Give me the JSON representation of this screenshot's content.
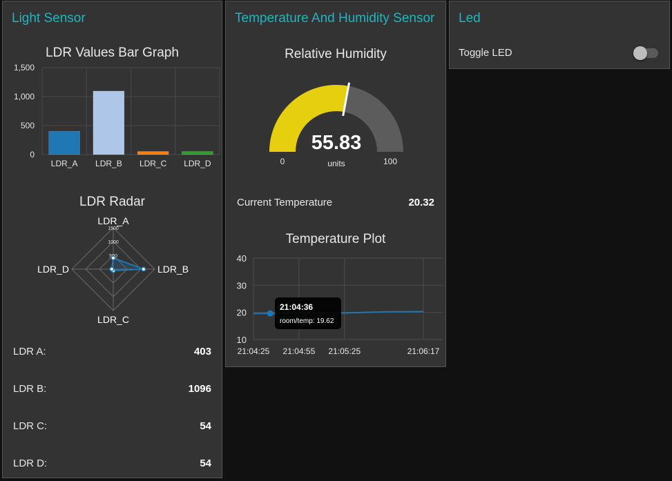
{
  "light_sensor": {
    "title": "Light Sensor",
    "bar_graph": {
      "title": "LDR Values Bar Graph",
      "y_ticks": [
        "1,500",
        "1,000",
        "500",
        "0"
      ],
      "categories": [
        "LDR_A",
        "LDR_B",
        "LDR_C",
        "LDR_D"
      ]
    },
    "radar": {
      "title": "LDR Radar",
      "axes": [
        "LDR_A",
        "LDR_B",
        "LDR_C",
        "LDR_D"
      ],
      "ring_labels": [
        "1500",
        "1000",
        "500"
      ]
    },
    "readings": [
      {
        "label": "LDR A:",
        "value": "403"
      },
      {
        "label": "LDR B:",
        "value": "1096"
      },
      {
        "label": "LDR C:",
        "value": "54"
      },
      {
        "label": "LDR D:",
        "value": "54"
      }
    ]
  },
  "temp_humidity": {
    "title": "Temperature And Humidity Sensor",
    "gauge": {
      "title": "Relative Humidity",
      "value": "55.83",
      "units": "units",
      "min": "0",
      "max": "100",
      "fill_fraction": 0.5583,
      "fill_color": "#e5cf0e",
      "track_color": "#5c5c5c"
    },
    "current_temperature": {
      "label": "Current Temperature",
      "value": "20.32"
    },
    "temp_plot": {
      "title": "Temperature Plot",
      "y_ticks": [
        "40",
        "30",
        "20",
        "10"
      ],
      "x_ticks": [
        "21:04:25",
        "21:04:55",
        "21:05:25",
        "21:06:17"
      ],
      "tooltip": {
        "time": "21:04:36",
        "series_value": "room/temp: 19.62"
      }
    }
  },
  "led": {
    "title": "Led",
    "toggle_label": "Toggle LED",
    "toggle_state": "off"
  },
  "chart_data": [
    {
      "type": "bar",
      "title": "LDR Values Bar Graph",
      "categories": [
        "LDR_A",
        "LDR_B",
        "LDR_C",
        "LDR_D"
      ],
      "values": [
        403,
        1096,
        54,
        54
      ],
      "colors": [
        "#1f77b4",
        "#aec7e8",
        "#ff7f0e",
        "#2ca02c"
      ],
      "ylim": [
        0,
        1500
      ],
      "yticks": [
        0,
        500,
        1000,
        1500
      ],
      "grid": true
    },
    {
      "type": "radar",
      "title": "LDR Radar",
      "axes": [
        "LDR_A",
        "LDR_B",
        "LDR_C",
        "LDR_D"
      ],
      "values": [
        403,
        1096,
        54,
        54
      ],
      "rmax": 1500,
      "color": "#1f77b4"
    },
    {
      "type": "line",
      "title": "Temperature Plot",
      "series": [
        {
          "name": "room/temp",
          "x": [
            "21:04:25",
            "21:04:36",
            "21:04:55",
            "21:05:25",
            "21:05:52",
            "21:06:17"
          ],
          "y": [
            19.6,
            19.62,
            19.7,
            19.8,
            20.2,
            20.3
          ]
        }
      ],
      "ylim": [
        10,
        40
      ],
      "yticks": [
        10,
        20,
        30,
        40
      ],
      "xticks": [
        "21:04:25",
        "21:04:55",
        "21:05:25",
        "21:06:17"
      ],
      "color": "#1f77b4",
      "grid": true
    }
  ]
}
